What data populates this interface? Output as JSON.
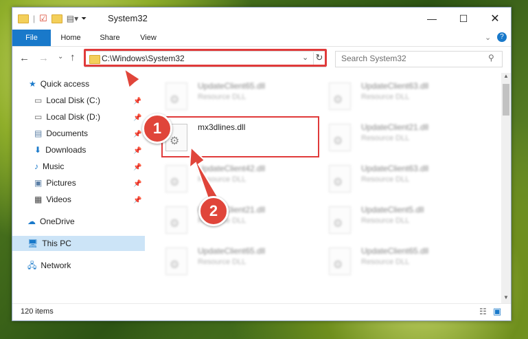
{
  "window": {
    "title": "System32"
  },
  "ribbon": {
    "tabs": [
      "File",
      "Home",
      "Share",
      "View"
    ]
  },
  "nav": {
    "address": "C:\\Windows\\System32",
    "search_placeholder": "Search System32"
  },
  "sidebar": {
    "items": [
      {
        "label": "Quick access"
      },
      {
        "label": "Local Disk (C:)"
      },
      {
        "label": "Local Disk (D:)"
      },
      {
        "label": "Documents"
      },
      {
        "label": "Downloads"
      },
      {
        "label": "Music"
      },
      {
        "label": "Pictures"
      },
      {
        "label": "Videos"
      },
      {
        "label": "OneDrive"
      },
      {
        "label": "This PC"
      },
      {
        "label": "Network"
      }
    ]
  },
  "files": [
    {
      "name": "UpdateClient65.dll",
      "type": "Resource DLL"
    },
    {
      "name": "UpdateClient63.dll",
      "type": "Resource DLL"
    },
    {
      "name": "mx3dlines.dll",
      "type": ""
    },
    {
      "name": "UpdateClient21.dll",
      "type": "Resource DLL"
    },
    {
      "name": "UpdateClient42.dll",
      "type": "Resource DLL"
    },
    {
      "name": "UpdateClient63.dll",
      "type": "Resource DLL"
    },
    {
      "name": "UpdateClient21.dll",
      "type": "Resource DLL"
    },
    {
      "name": "UpdateClient5.dll",
      "type": "Resource DLL"
    },
    {
      "name": "UpdateClient65.dll",
      "type": "Resource DLL"
    },
    {
      "name": "UpdateClient65.dll",
      "type": "Resource DLL"
    }
  ],
  "status": {
    "item_count": "120 items"
  },
  "annotations": {
    "step1": "1",
    "step2": "2"
  },
  "colors": {
    "accent": "#1979ca",
    "highlight_red": "#e03a3a"
  }
}
